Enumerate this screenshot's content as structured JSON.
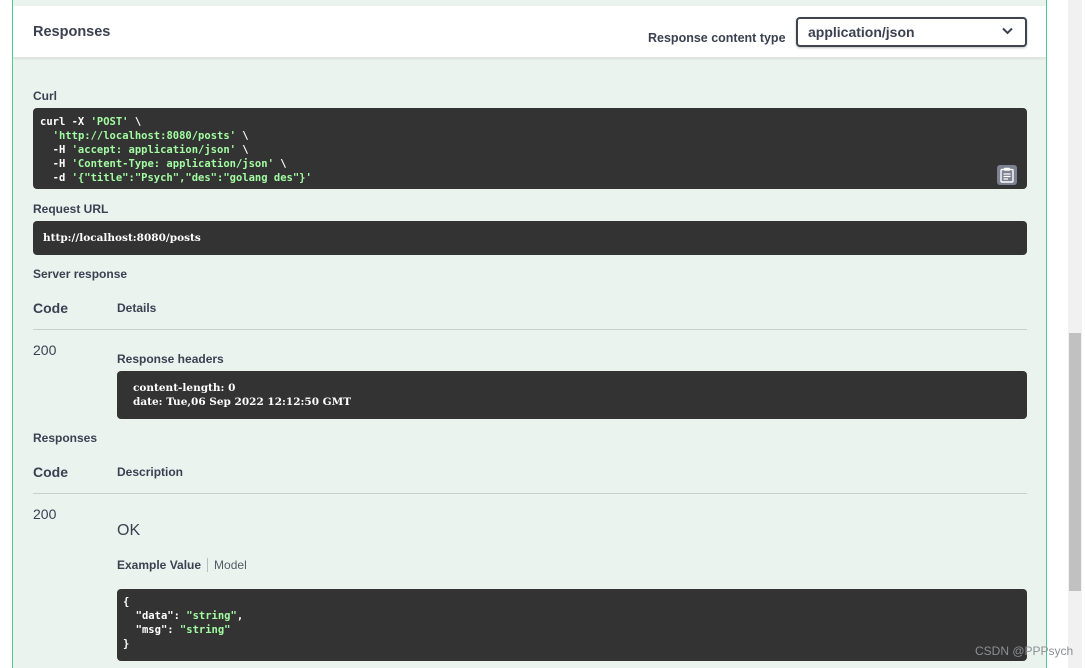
{
  "header": {
    "title": "Responses",
    "content_type_label": "Response content type",
    "content_type_value": "application/json"
  },
  "curl": {
    "label": "Curl",
    "lines": [
      {
        "plain": "curl -X ",
        "str": "'POST'",
        "tail": " \\"
      },
      {
        "plain": "  ",
        "str": "'http://localhost:8080/posts'",
        "tail": " \\"
      },
      {
        "plain": "  -H ",
        "str": "'accept: application/json'",
        "tail": " \\"
      },
      {
        "plain": "  -H ",
        "str": "'Content-Type: application/json'",
        "tail": " \\"
      },
      {
        "plain": "  -d ",
        "str": "'{\"title\":\"Psych\",\"des\":\"golang des\"}'",
        "tail": ""
      }
    ]
  },
  "request_url": {
    "label": "Request URL",
    "value": "http://localhost:8080/posts"
  },
  "server_response": {
    "label": "Server response",
    "col_code": "Code",
    "col_details": "Details",
    "code": "200",
    "headers_label": "Response headers",
    "headers_lines": [
      "content-length: 0",
      "date: Tue,06 Sep 2022 12:12:50 GMT"
    ]
  },
  "responses": {
    "label": "Responses",
    "col_code": "Code",
    "col_description": "Description",
    "code": "200",
    "description": "OK",
    "tab_example": "Example Value",
    "tab_model": "Model",
    "example": {
      "open": "{",
      "data_key": "\"data\"",
      "data_val": "\"string\"",
      "msg_key": "\"msg\"",
      "msg_val": "\"string\"",
      "close": "}"
    }
  },
  "watermark": "CSDN @PPPsych"
}
